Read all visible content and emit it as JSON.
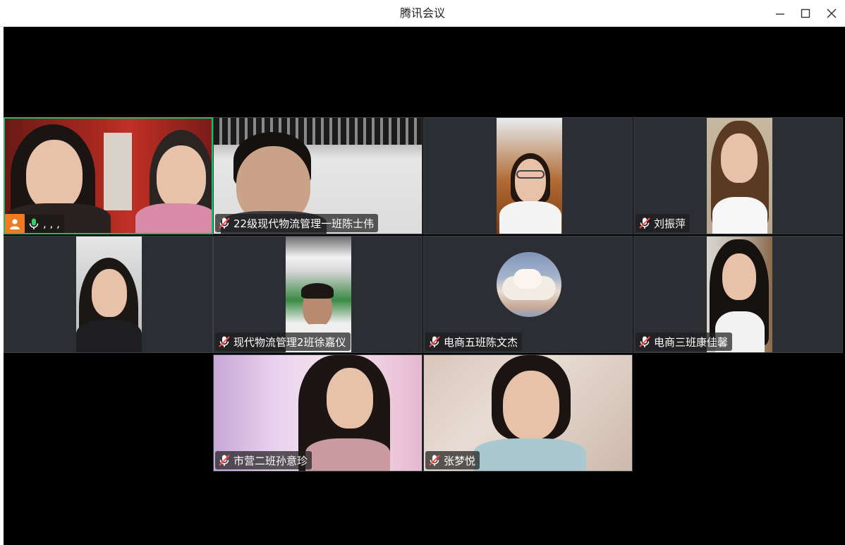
{
  "window": {
    "title": "腾讯会议"
  },
  "colors": {
    "active_border": "#18c06a",
    "tile_bg": "#2b2e33",
    "host_badge": "#f07a20",
    "mic_on": "#32d26a",
    "mic_off_slash": "#ff4d4f"
  },
  "participants": [
    {
      "name": ", , ,",
      "mic": "on",
      "host": true,
      "active": true
    },
    {
      "name": "22级现代物流管理一班陈士伟",
      "mic": "muted"
    },
    {
      "name": "",
      "mic": "none"
    },
    {
      "name": "刘振萍",
      "mic": "muted"
    },
    {
      "name": "",
      "mic": "none"
    },
    {
      "name": "现代物流管理2班徐嘉仪",
      "mic": "muted"
    },
    {
      "name": "电商五班陈文杰",
      "mic": "muted",
      "video_off": true,
      "avatar": "cloud-avatar"
    },
    {
      "name": "电商三班康佳馨",
      "mic": "muted"
    },
    {
      "name": "市营二班孙意珍",
      "mic": "muted"
    },
    {
      "name": "张梦悦",
      "mic": "muted"
    }
  ]
}
